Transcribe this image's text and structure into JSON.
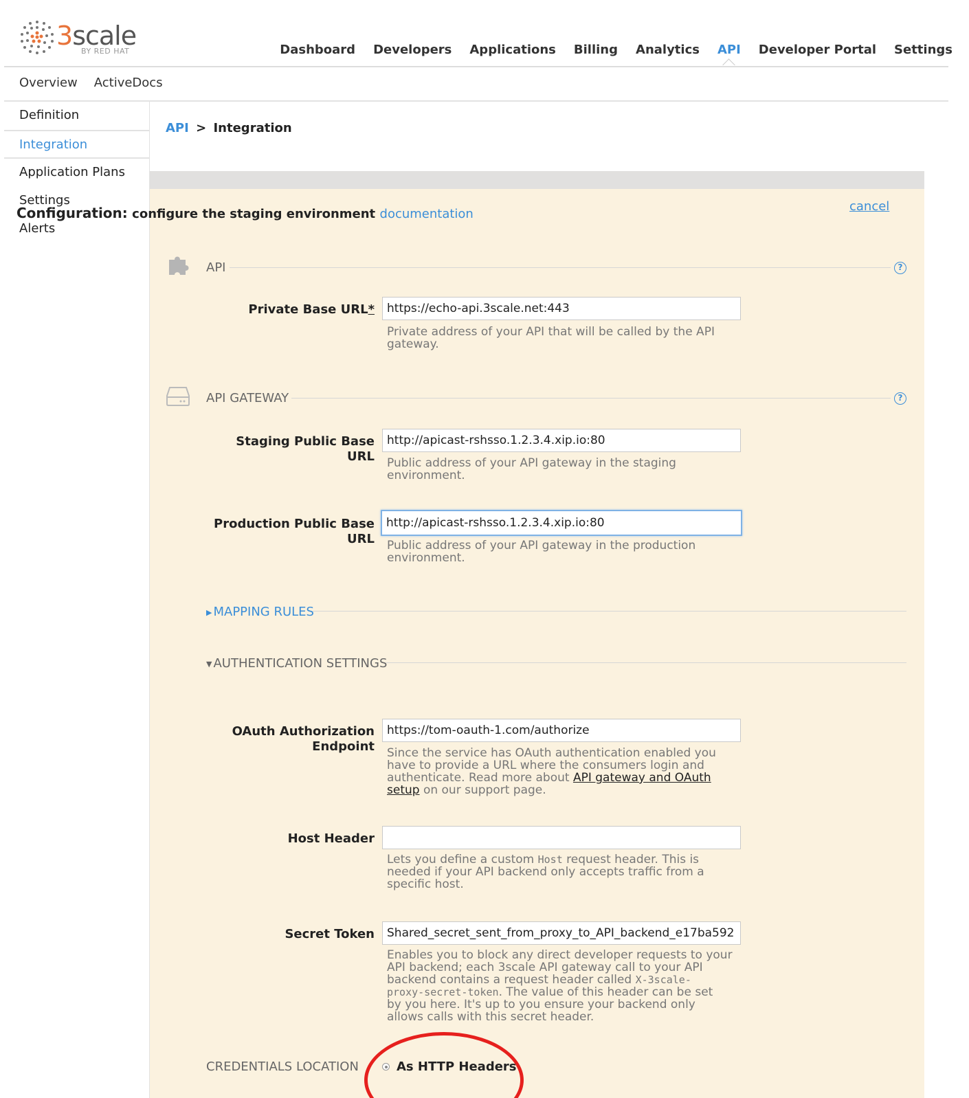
{
  "brand": {
    "logo_text_a": "3",
    "logo_text_b": "scale",
    "logo_sub": "BY RED HAT"
  },
  "topnav": [
    {
      "label": "Dashboard",
      "active": false
    },
    {
      "label": "Developers",
      "active": false
    },
    {
      "label": "Applications",
      "active": false
    },
    {
      "label": "Billing",
      "active": false
    },
    {
      "label": "Analytics",
      "active": false
    },
    {
      "label": "API",
      "active": true
    },
    {
      "label": "Developer Portal",
      "active": false
    },
    {
      "label": "Settings",
      "active": false
    }
  ],
  "subnav": [
    "Overview",
    "ActiveDocs"
  ],
  "sidebar": [
    {
      "label": "Definition",
      "active": false
    },
    {
      "label": "Integration",
      "active": true
    },
    {
      "label": "Application Plans",
      "active": false
    },
    {
      "label": "Settings",
      "active": false
    },
    {
      "label": "Alerts",
      "active": false
    }
  ],
  "breadcrumb": {
    "root": "API",
    "separator": ">",
    "current": "Integration"
  },
  "config": {
    "title": "Configuration:",
    "subtitle": "configure the staging environment",
    "doc_link": "documentation",
    "cancel": "cancel"
  },
  "sections": {
    "api": {
      "title": "API",
      "help": "?"
    },
    "gateway": {
      "title": "API GATEWAY",
      "help": "?"
    },
    "mapping": {
      "title": "MAPPING RULES"
    },
    "auth": {
      "title": "AUTHENTICATION SETTINGS"
    }
  },
  "fields": {
    "private_base_url": {
      "label": "Private Base URL",
      "required_mark": "*",
      "value": "https://echo-api.3scale.net:443",
      "help": "Private address of your API that will be called by the API gateway."
    },
    "staging_url": {
      "label": "Staging Public Base URL",
      "value": "http://apicast-rshsso.1.2.3.4.xip.io:80",
      "help": "Public address of your API gateway in the staging environment."
    },
    "production_url": {
      "label_line1": "Production Public Base",
      "label_line2": "URL",
      "value": "http://apicast-rshsso.1.2.3.4.xip.io:80",
      "help": "Public address of your API gateway in the production environment."
    },
    "oauth_endpoint": {
      "label_line1": "OAuth Authorization",
      "label_line2": "Endpoint",
      "value": "https://tom-oauth-1.com/authorize",
      "help_line1": "Since the service has OAuth authentication enabled you",
      "help_line2": "have to provide a URL where the consumers login and",
      "help_line3": "authenticate. Read more about",
      "help_link_a": "API gateway and OAuth",
      "help_link_b": "setup",
      "help_line4": "on our support page."
    },
    "host_header": {
      "label": "Host Header",
      "value": "",
      "help_pre": "Lets you define a custom",
      "help_code": "Host",
      "help_post": "request header. This is",
      "help_line2": "needed if your API backend only accepts traffic from a",
      "help_line3": "specific host."
    },
    "secret_token": {
      "label": "Secret Token",
      "value": "Shared_secret_sent_from_proxy_to_API_backend_e17ba592",
      "help_line1": "Enables you to block any direct developer requests to your",
      "help_line2": "API backend; each 3scale API gateway call to your API",
      "help_line3_pre": "backend contains a request header called",
      "help_code_a": "X-3scale-",
      "help_code_b": "proxy-secret-token",
      "help_line4_post": ". The value of this header can be set",
      "help_line5": "by you here. It's up to you ensure your backend only",
      "help_line6": "allows calls with this secret header."
    }
  },
  "credentials": {
    "label": "CREDENTIALS LOCATION",
    "option": "As HTTP Headers"
  },
  "colors": {
    "accent": "#3b8ed8",
    "panel_bg": "#fbf2df",
    "annotation": "#e6201d"
  }
}
